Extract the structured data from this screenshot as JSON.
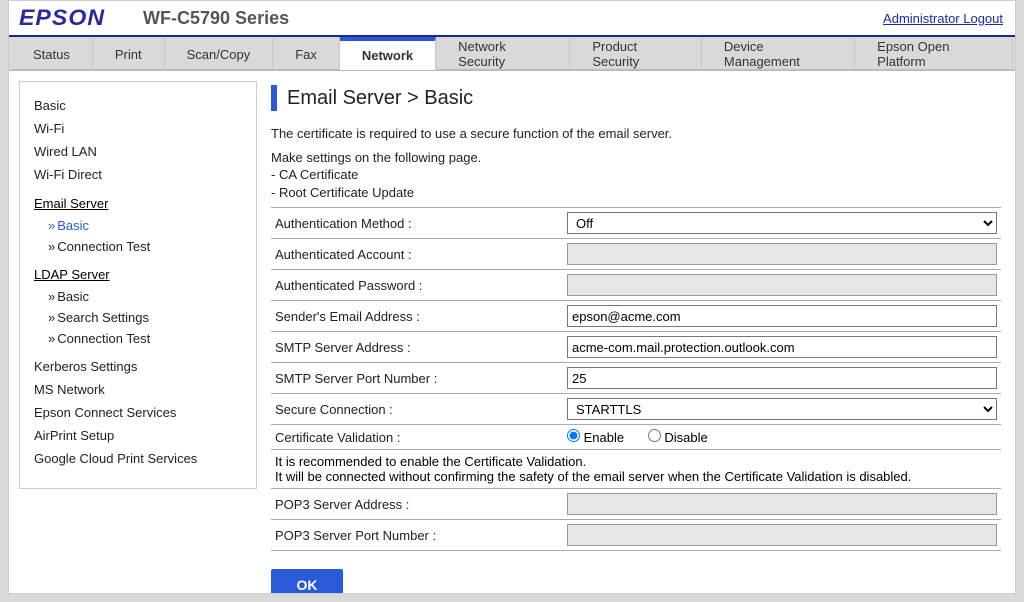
{
  "header": {
    "brand": "EPSON",
    "model": "WF-C5790 Series",
    "logout": "Administrator Logout"
  },
  "tabs": [
    "Status",
    "Print",
    "Scan/Copy",
    "Fax",
    "Network",
    "Network Security",
    "Product Security",
    "Device Management",
    "Epson Open Platform"
  ],
  "sidebar": {
    "basic": "Basic",
    "wifi": "Wi-Fi",
    "wired_lan": "Wired LAN",
    "wifi_direct": "Wi-Fi Direct",
    "email_server": {
      "label": "Email Server",
      "items": [
        "Basic",
        "Connection Test"
      ]
    },
    "ldap_server": {
      "label": "LDAP Server",
      "items": [
        "Basic",
        "Search Settings",
        "Connection Test"
      ]
    },
    "kerberos": "Kerberos Settings",
    "ms_network": "MS Network",
    "epson_connect": "Epson Connect Services",
    "airprint": "AirPrint Setup",
    "gcp": "Google Cloud Print Services"
  },
  "page": {
    "title": "Email Server > Basic",
    "info": [
      "The certificate is required to use a secure function of the email server.",
      "Make settings on the following page.",
      "- CA Certificate",
      "- Root Certificate Update"
    ]
  },
  "form": {
    "auth_method": {
      "label": "Authentication Method :",
      "value": "Off"
    },
    "auth_account": {
      "label": "Authenticated Account :",
      "value": ""
    },
    "auth_password": {
      "label": "Authenticated Password :",
      "value": ""
    },
    "sender_email": {
      "label": "Sender's Email Address :",
      "value": "epson@acme.com"
    },
    "smtp_address": {
      "label": "SMTP Server Address :",
      "value": "acme-com.mail.protection.outlook.com"
    },
    "smtp_port": {
      "label": "SMTP Server Port Number :",
      "value": "25"
    },
    "secure_conn": {
      "label": "Secure Connection :",
      "value": "STARTTLS"
    },
    "cert_validation": {
      "label": "Certificate Validation :",
      "enable": "Enable",
      "disable": "Disable",
      "selected": "Enable"
    },
    "cert_note": [
      "It is recommended to enable the Certificate Validation.",
      "It will be connected without confirming the safety of the email server when the Certificate Validation is disabled."
    ],
    "pop3_address": {
      "label": "POP3 Server Address :",
      "value": ""
    },
    "pop3_port": {
      "label": "POP3 Server Port Number :",
      "value": ""
    },
    "ok": "OK"
  }
}
